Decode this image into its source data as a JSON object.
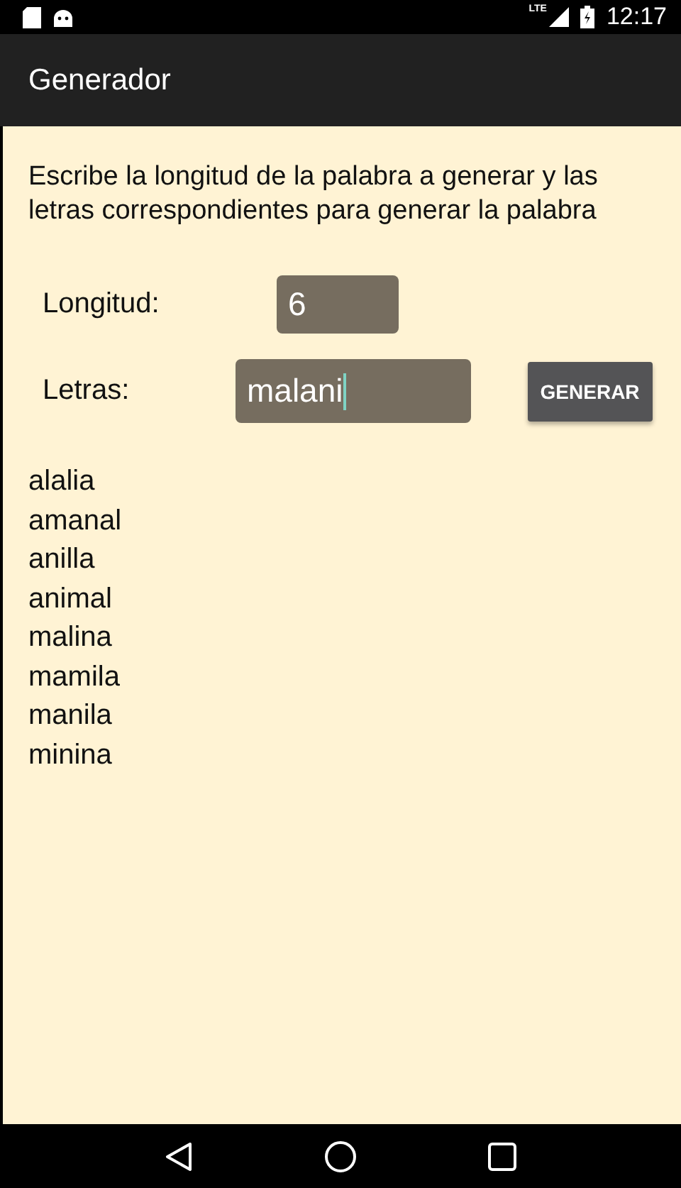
{
  "status_bar": {
    "time": "12:17",
    "network": "LTE"
  },
  "app_bar": {
    "title": "Generador"
  },
  "instructions": "Escribe la longitud de la palabra a generar y las letras correspondientes para generar la palabra",
  "form": {
    "length_label": "Longitud:",
    "length_value": "6",
    "letters_label": "Letras:",
    "letters_value": "malani",
    "letters_focused": true,
    "button": "GENERAR"
  },
  "results": [
    {
      "word": "alalia"
    },
    {
      "word": "amanal"
    },
    {
      "word": "anilla"
    },
    {
      "word": "animal"
    },
    {
      "word": "malina"
    },
    {
      "word": "mamila"
    },
    {
      "word": "manila"
    },
    {
      "word": "minina"
    }
  ]
}
